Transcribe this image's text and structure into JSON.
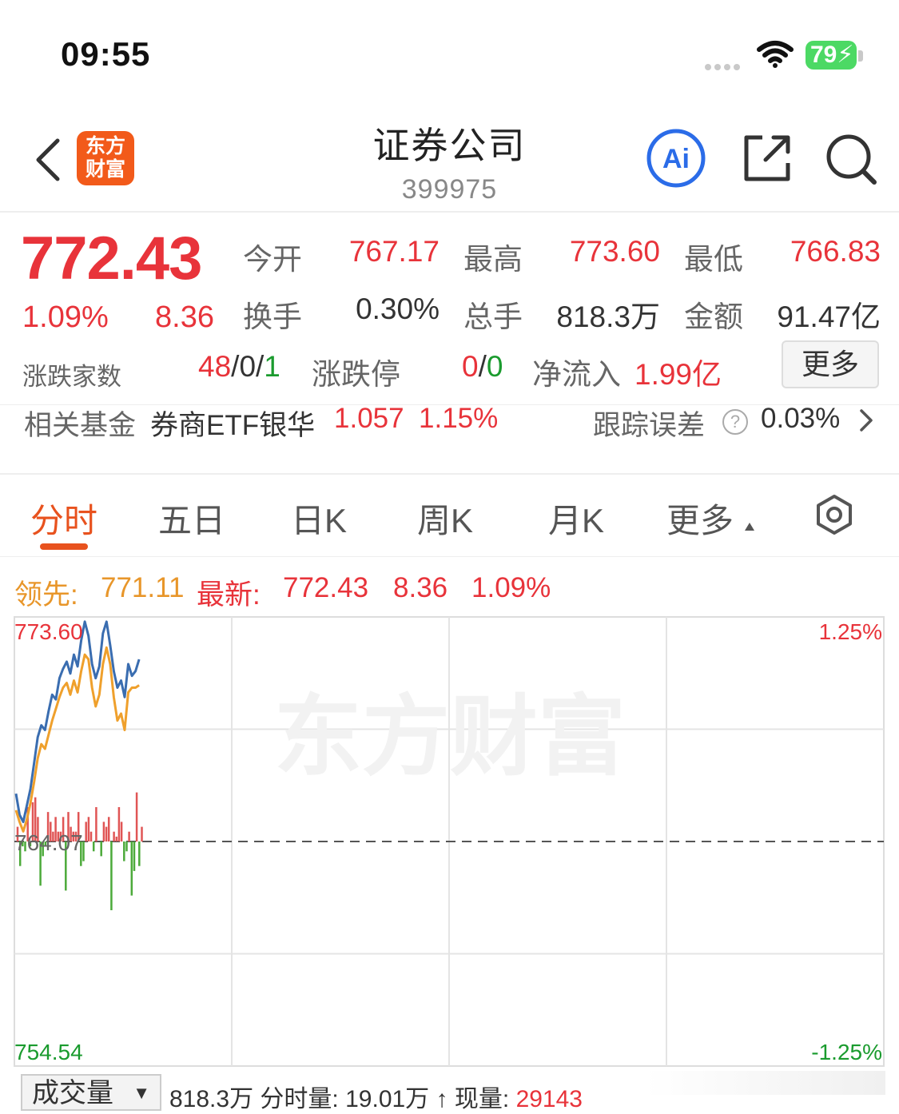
{
  "status": {
    "time": "09:55",
    "battery": "79"
  },
  "header": {
    "logo_line1": "东方",
    "logo_line2": "财富",
    "title": "证券公司",
    "code": "399975",
    "ai_label": "Ai"
  },
  "quote": {
    "price": "772.43",
    "pct": "1.09%",
    "change": "8.36",
    "open_label": "今开",
    "open": "767.17",
    "high_label": "最高",
    "high": "773.60",
    "low_label": "最低",
    "low": "766.83",
    "turnover_label": "换手",
    "turnover": "0.30%",
    "volume_label": "总手",
    "volume": "818.3万",
    "amount_label": "金额",
    "amount": "91.47亿",
    "breadth_label": "涨跌家数",
    "breadth_up": "48",
    "breadth_sep1": "/",
    "breadth_flat": "0",
    "breadth_sep2": "/",
    "breadth_down": "1",
    "limit_label": "涨跌停",
    "limit_up": "0",
    "limit_sep": "/",
    "limit_down": "0",
    "netflow_label": "净流入",
    "netflow": "1.99亿",
    "more_label": "更多"
  },
  "fund": {
    "label": "相关基金",
    "name": "券商ETF银华",
    "price": "1.057",
    "pct": "1.15%",
    "track_label": "跟踪误差",
    "track": "0.03%"
  },
  "tabs": [
    "分时",
    "五日",
    "日K",
    "周K",
    "月K",
    "更多"
  ],
  "info": {
    "lead_label": "领先:",
    "lead": "771.11",
    "latest_label": "最新:",
    "latest": "772.43",
    "change": "8.36",
    "pct": "1.09%"
  },
  "chart_data": {
    "type": "line",
    "y_top_label": "773.60",
    "y_mid_label": "764.07",
    "y_bottom_label": "754.54",
    "pct_top_label": "1.25%",
    "pct_bottom_label": "-1.25%",
    "ylim": [
      754.54,
      773.6
    ],
    "prev_close": 764.07,
    "total_minutes": 240,
    "watermark": "东方财富",
    "series": [
      {
        "values": [
          766.1,
          765.2,
          764.9,
          765.6,
          766.3,
          767.4,
          768.5,
          769.0,
          768.8,
          769.6,
          770.3,
          770.1,
          771.0,
          771.4,
          771.7,
          771.2,
          772.0,
          771.5,
          772.6,
          773.4,
          772.8,
          771.6,
          771.0,
          771.5,
          772.9,
          773.4,
          772.4,
          771.3,
          770.6,
          770.9,
          770.2,
          771.6,
          771.1,
          771.3,
          771.8
        ]
      },
      {
        "values": [
          765.4,
          764.9,
          764.5,
          765.0,
          765.7,
          766.6,
          767.6,
          768.2,
          768.0,
          768.6,
          769.2,
          769.7,
          770.2,
          770.6,
          770.8,
          770.3,
          770.9,
          770.4,
          771.3,
          772.0,
          771.8,
          770.6,
          769.8,
          770.3,
          771.6,
          772.3,
          771.6,
          770.2,
          769.2,
          769.5,
          768.8,
          770.4,
          770.6,
          770.6,
          770.7
        ]
      }
    ],
    "volume_bars": [
      3,
      -5,
      -1,
      -2,
      7,
      -1,
      8,
      9,
      5,
      -9,
      -3,
      -1,
      6,
      4,
      2,
      5,
      2,
      2,
      5,
      -10,
      6,
      3,
      2,
      2,
      6,
      -5,
      -4,
      4,
      5,
      2,
      -2,
      7,
      0,
      -3,
      4,
      3,
      5,
      -14,
      2,
      1,
      7,
      4,
      -4,
      -2,
      2,
      -11,
      -6,
      10,
      -5,
      3
    ]
  },
  "bottom": {
    "vol_label": "成交量",
    "total": "818.3万",
    "minute_label": "分时量:",
    "minute": "19.01万",
    "arrow": "↑",
    "now_label": "现量:",
    "now": "29143"
  }
}
